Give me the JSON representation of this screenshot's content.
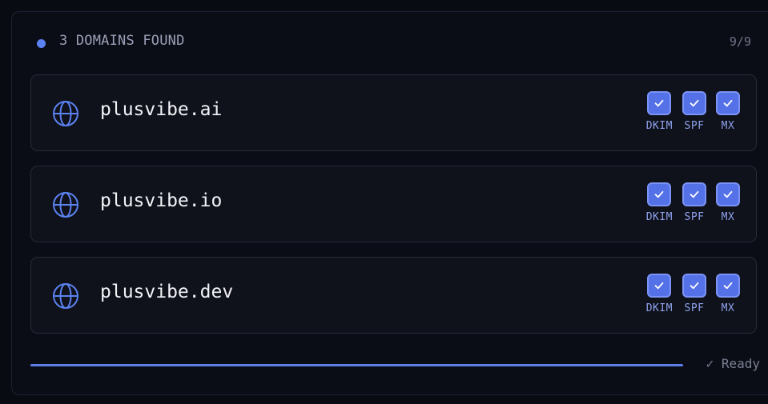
{
  "header": {
    "title": "3 DOMAINS FOUND",
    "count": "9/9"
  },
  "domains": [
    {
      "name": "plusvibe.ai",
      "checks": [
        "DKIM",
        "SPF",
        "MX"
      ]
    },
    {
      "name": "plusvibe.io",
      "checks": [
        "DKIM",
        "SPF",
        "MX"
      ]
    },
    {
      "name": "plusvibe.dev",
      "checks": [
        "DKIM",
        "SPF",
        "MX"
      ]
    }
  ],
  "footer": {
    "progress": 1.0,
    "status": "✓ Ready"
  },
  "colors": {
    "accent": "#5b82f0",
    "check_fill": "#5571e8",
    "background": "#090b12"
  },
  "icons": {
    "domain": "globe-icon",
    "check": "checkmark-icon"
  }
}
